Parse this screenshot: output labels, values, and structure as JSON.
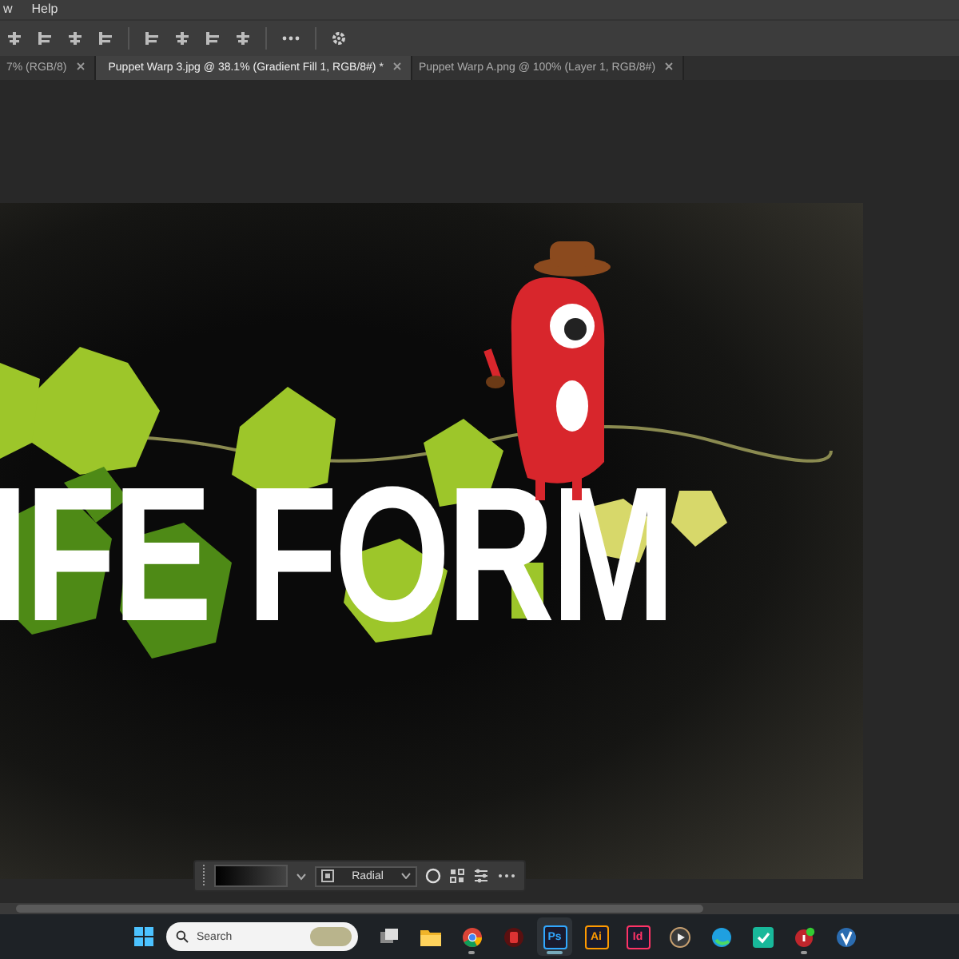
{
  "menu_bar": {
    "items": [
      "w",
      "Help"
    ]
  },
  "tabs": [
    {
      "label": "7% (RGB/8)",
      "selected": false
    },
    {
      "label": "Puppet Warp 3.jpg @ 38.1% (Gradient Fill 1, RGB/8#) *",
      "selected": true
    },
    {
      "label": "Puppet Warp A.png @ 100% (Layer 1, RGB/8#)",
      "selected": false
    }
  ],
  "document": {
    "headline": "IFE FORM"
  },
  "contextual_bar": {
    "gradient_type": "Radial"
  },
  "taskbar": {
    "search": {
      "placeholder": "Search"
    },
    "apps": [
      {
        "kind": "taskview",
        "running": false,
        "selected": false
      },
      {
        "kind": "folder",
        "running": false,
        "selected": false
      },
      {
        "kind": "chrome",
        "running": true,
        "selected": false
      },
      {
        "kind": "redapp",
        "running": false,
        "selected": false
      },
      {
        "kind": "letter",
        "label": "Ps",
        "color": "#31a8ff",
        "running": true,
        "selected": true
      },
      {
        "kind": "letter",
        "label": "Ai",
        "color": "#ff9a00",
        "running": false,
        "selected": false
      },
      {
        "kind": "letter",
        "label": "Id",
        "color": "#ff3366",
        "running": false,
        "selected": false
      },
      {
        "kind": "player",
        "running": false,
        "selected": false
      },
      {
        "kind": "edge",
        "running": false,
        "selected": false
      },
      {
        "kind": "check",
        "running": false,
        "selected": false
      },
      {
        "kind": "badge",
        "running": true,
        "selected": false
      },
      {
        "kind": "vapp",
        "running": false,
        "selected": false
      }
    ]
  }
}
